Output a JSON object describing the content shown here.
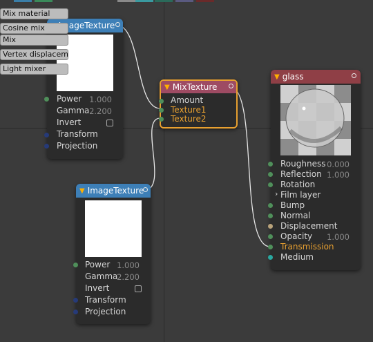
{
  "palette_swatches": [
    "#3a7ea8",
    "#3a8a5a",
    "#8a8a8a",
    "#3a9aa0",
    "#2a6a5a",
    "#5a5a80",
    "#6a2a2a"
  ],
  "menu": {
    "items": [
      "Mix material",
      "Cosine mix",
      "Mix",
      "Vertex displaceme",
      "Light mixer"
    ]
  },
  "node_image1": {
    "title": "ImageTexture",
    "header_color": "#3d7fb7",
    "power_label": "Power",
    "power_value": "1.000",
    "gamma_label": "Gamma",
    "gamma_value": "2.200",
    "invert_label": "Invert",
    "transform_label": "Transform",
    "projection_label": "Projection"
  },
  "node_image2": {
    "title": "ImageTexture",
    "header_color": "#3d7fb7",
    "power_label": "Power",
    "power_value": "1.000",
    "gamma_label": "Gamma",
    "gamma_value": "2.200",
    "invert_label": "Invert",
    "transform_label": "Transform",
    "projection_label": "Projection"
  },
  "node_mix": {
    "title": "MixTexture",
    "header_color": "#9e4b63",
    "amount_label": "Amount",
    "texture1_label": "Texture1",
    "texture2_label": "Texture2",
    "highlight_color": "#e8a030"
  },
  "node_glass": {
    "title": "glass",
    "header_color": "#8f3f46",
    "roughness_label": "Roughness",
    "roughness_value": "0.000",
    "reflection_label": "Reflection",
    "reflection_value": "1.000",
    "rotation_label": "Rotation",
    "film_layer_label": "Film layer",
    "bump_label": "Bump",
    "normal_label": "Normal",
    "displacement_label": "Displacement",
    "opacity_label": "Opacity",
    "opacity_value": "1.000",
    "transmission_label": "Transmission",
    "medium_label": "Medium"
  }
}
